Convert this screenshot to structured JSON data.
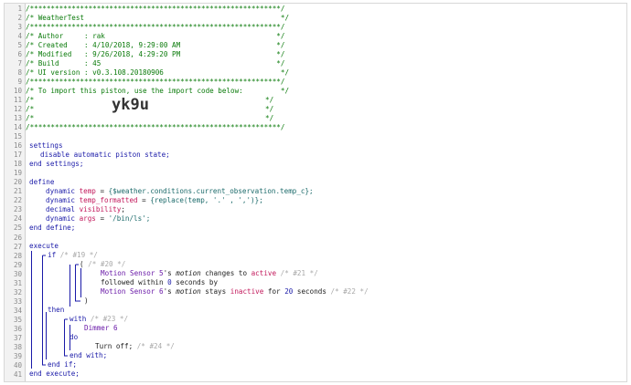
{
  "header": {
    "stars_line": "/************************************************************/",
    "title_line": "/* WeatherTest                                               */",
    "author_line": "/* Author     : rak                                         */",
    "created_line": "/* Created    : 4/10/2018, 9:29:00 AM                       */",
    "modified_line": "/* Modified   : 9/26/2018, 4:29:20 PM                       */",
    "build_line": "/* Build      : 45                                          */",
    "ui_line": "/* UI version : v0.3.108.20180906                            */",
    "import_line": "/* To import this piston, use the import code below:         */",
    "empty_left": "/*",
    "empty_right": "*/",
    "import_code": "yk9u"
  },
  "line_numbers": [
    "1",
    "2",
    "3",
    "4",
    "5",
    "6",
    "7",
    "8",
    "9",
    "10",
    "11",
    "12",
    "13",
    "14",
    "15",
    "16",
    "17",
    "18",
    "19",
    "20",
    "21",
    "22",
    "23",
    "24",
    "25",
    "26",
    "27",
    "28",
    "29",
    "30",
    "31",
    "32",
    "33",
    "34",
    "35",
    "36",
    "37",
    "38",
    "39",
    "40",
    "41"
  ],
  "settings": {
    "open": "settings",
    "body_kw": "disable automatic piston state;",
    "close": "end settings;"
  },
  "define": {
    "open": "define",
    "lines": [
      {
        "type": "dynamic",
        "name": "temp",
        "eq": " = ",
        "value": "{$weather.conditions.current_observation.temp_c};"
      },
      {
        "type": "dynamic",
        "name": "temp_formatted",
        "eq": " = ",
        "value": "{replace(temp, '.' , ',')};"
      },
      {
        "type": "decimal",
        "name": "visibility",
        "eq": "",
        "value": ";"
      },
      {
        "type": "dynamic",
        "name": "args",
        "eq": " = ",
        "value": "'/bin/ls';"
      }
    ],
    "close": "end define;"
  },
  "execute": {
    "open": "execute",
    "if_kw": "if",
    "if_cmt": "/* #19 */",
    "paren_open": "(",
    "paren_cmt": "/* #20 */",
    "cond1": {
      "device": "Motion Sensor 5",
      "poss": "'s ",
      "attr": "motion",
      "verb": " changes to ",
      "value": "active",
      "cmt": "/* #21 */"
    },
    "followed": {
      "pre": "followed within ",
      "num": "0",
      "post": " seconds by"
    },
    "cond2": {
      "device": "Motion Sensor 6",
      "poss": "'s ",
      "attr": "motion",
      "verb": " stays ",
      "value": "inactive",
      "for": " for ",
      "num": "20",
      "unit": " seconds",
      "cmt": "/* #22 */"
    },
    "paren_close": ")",
    "then_kw": "then",
    "with_kw": "with",
    "with_cmt": "/* #23 */",
    "device": "Dimmer 6",
    "do_kw": "do",
    "action": "Turn off;",
    "action_cmt": "/* #24 */",
    "end_with": "end with;",
    "end_if": "end if;",
    "close": "end execute;"
  },
  "colors": {
    "comment_green": "#0a7a0a",
    "keyword_blue": "#1a1aa8",
    "variable_red": "#c2185b",
    "device_purple": "#6a1aa8",
    "faint_comment": "#a8a8a8"
  }
}
